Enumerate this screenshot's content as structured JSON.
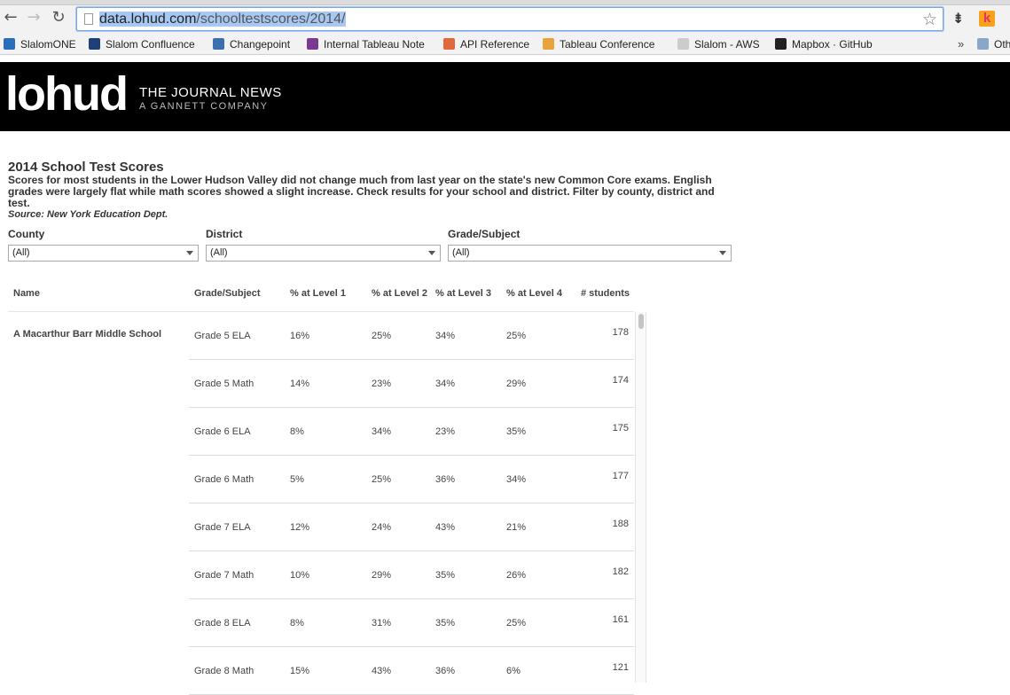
{
  "browser": {
    "url_host": "data.lohud.com",
    "url_path": "/schooltestscores/2014/",
    "bookmarks": [
      {
        "label": "SlalomONE",
        "color": "#2a6ebb"
      },
      {
        "label": "Slalom Confluence",
        "color": "#1f3f77"
      },
      {
        "label": "Changepoint",
        "color": "#3a6fb0"
      },
      {
        "label": "Internal Tableau Note",
        "color": "#7a3b8f"
      },
      {
        "label": "API Reference",
        "color": "#e0683c"
      },
      {
        "label": "Tableau Conference",
        "color": "#e8a33c"
      },
      {
        "label": "Slalom - AWS",
        "color": "#cccccc"
      },
      {
        "label": "Mapbox · GitHub",
        "color": "#222222"
      },
      {
        "label": "Oth",
        "color": "#8aa6c8"
      }
    ],
    "more_label": "»"
  },
  "site": {
    "logo": "lohud",
    "brand": "THE JOURNAL NEWS",
    "tagline": "A GANNETT COMPANY"
  },
  "page": {
    "title": "2014 School Test Scores",
    "description": "Scores for most students in the Lower Hudson Valley did not change much from last year on the state's new Common Core exams. English grades were largely flat while math scores showed a slight increase. Check results for your school and district. Filter by county, district and test.",
    "source": "Source: New York Education Dept."
  },
  "filters": {
    "county": {
      "label": "County",
      "value": "(All)"
    },
    "district": {
      "label": "District",
      "value": "(All)"
    },
    "grade_subject": {
      "label": "Grade/Subject",
      "value": "(All)"
    }
  },
  "table": {
    "headers": [
      "Name",
      "Grade/Subject",
      "% at Level 1",
      "% at Level 2",
      "% at Level 3",
      "% at Level 4",
      "# students"
    ],
    "school": "A Macarthur Barr Middle School",
    "rows": [
      [
        "Grade 5 ELA",
        "16%",
        "25%",
        "34%",
        "25%",
        "178"
      ],
      [
        "Grade 5 Math",
        "14%",
        "23%",
        "34%",
        "29%",
        "174"
      ],
      [
        "Grade 6 ELA",
        "8%",
        "34%",
        "23%",
        "35%",
        "175"
      ],
      [
        "Grade 6 Math",
        "5%",
        "25%",
        "36%",
        "34%",
        "177"
      ],
      [
        "Grade 7 ELA",
        "12%",
        "24%",
        "43%",
        "21%",
        "188"
      ],
      [
        "Grade 7 Math",
        "10%",
        "29%",
        "35%",
        "26%",
        "182"
      ],
      [
        "Grade 8 ELA",
        "8%",
        "31%",
        "35%",
        "25%",
        "161"
      ],
      [
        "Grade 8 Math",
        "15%",
        "43%",
        "36%",
        "6%",
        "121"
      ]
    ]
  }
}
